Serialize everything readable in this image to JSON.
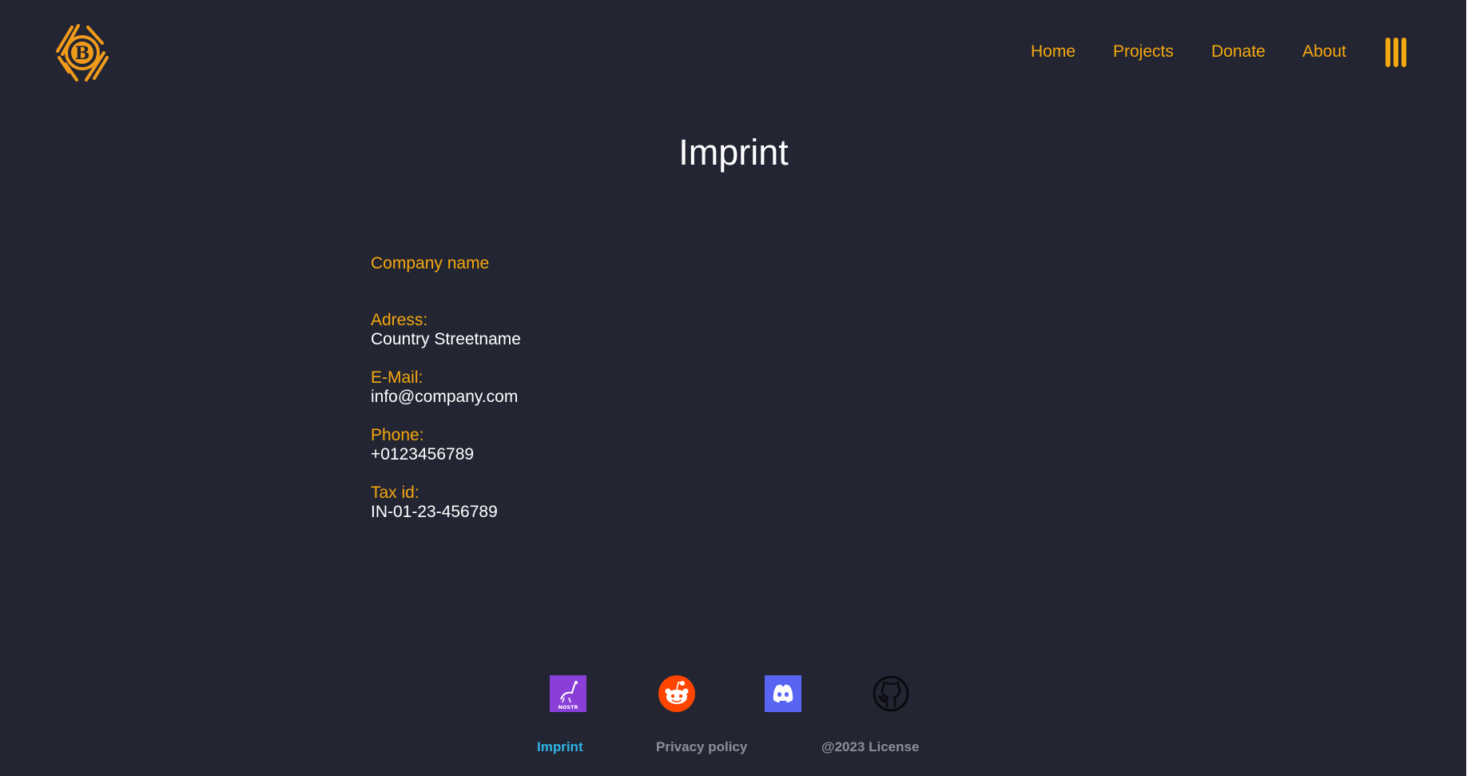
{
  "header": {
    "logo_icon": "bitcoin-logo-icon",
    "nav": [
      {
        "label": "Home"
      },
      {
        "label": "Projects"
      },
      {
        "label": "Donate"
      },
      {
        "label": "About"
      }
    ],
    "menu_icon": "menu-icon"
  },
  "main": {
    "title": "Imprint",
    "company_name": "Company name",
    "fields": [
      {
        "label": "Adress:",
        "value": "Country Streetname"
      },
      {
        "label": "E-Mail:",
        "value": "info@company.com"
      },
      {
        "label": "Phone:",
        "value": "+0123456789"
      },
      {
        "label": "Tax id:",
        "value": "IN-01-23-456789"
      }
    ]
  },
  "footer": {
    "socials": [
      {
        "icon": "nostr-icon",
        "label": "NOSTR"
      },
      {
        "icon": "reddit-icon"
      },
      {
        "icon": "discord-icon"
      },
      {
        "icon": "github-icon"
      }
    ],
    "links": [
      {
        "label": "Imprint"
      },
      {
        "label": "Privacy policy"
      },
      {
        "label": "@2023 License"
      }
    ]
  },
  "colors": {
    "background": "#232533",
    "accent": "#f5a80e",
    "active_link": "#2fb4e6",
    "muted_link": "#8e8f96",
    "nostr": "#8b3fd9",
    "reddit": "#ff4500",
    "discord": "#5865f2"
  }
}
